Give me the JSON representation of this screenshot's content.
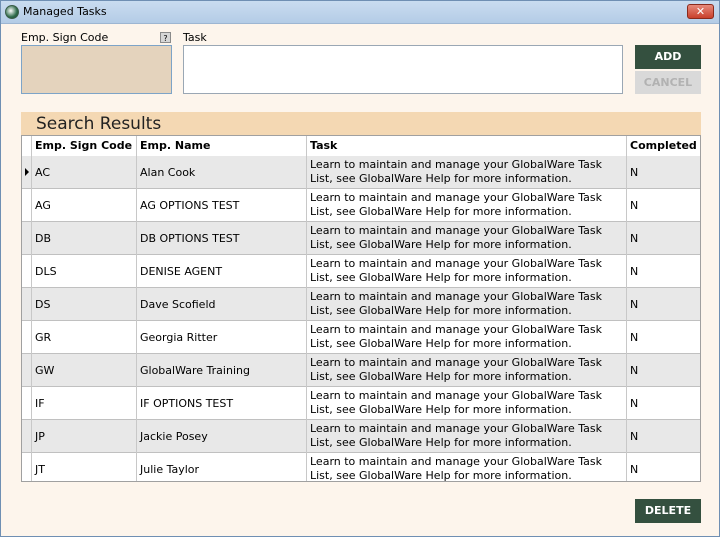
{
  "window": {
    "title": "Managed Tasks",
    "close_label": "✕"
  },
  "form": {
    "emp_sign_code_label": "Emp. Sign Code",
    "help_label": "?",
    "task_label": "Task",
    "emp_sign_code_value": "",
    "task_value": ""
  },
  "buttons": {
    "add": "ADD",
    "cancel": "CANCEL",
    "delete": "DELETE"
  },
  "results": {
    "title": "Search Results",
    "columns": [
      "Emp. Sign Code",
      "Emp. Name",
      "Task",
      "Completed"
    ],
    "rows": [
      {
        "code": "AC",
        "name": "Alan Cook",
        "task": "Learn to maintain and manage your GlobalWare Task List, see GlobalWare Help for more information.",
        "completed": "N"
      },
      {
        "code": "AG",
        "name": "AG OPTIONS TEST",
        "task": "Learn to maintain and manage your GlobalWare Task List, see GlobalWare Help for more information.",
        "completed": "N"
      },
      {
        "code": "DB",
        "name": "DB OPTIONS TEST",
        "task": "Learn to maintain and manage your GlobalWare Task List, see GlobalWare Help for more information.",
        "completed": "N"
      },
      {
        "code": "DLS",
        "name": "DENISE AGENT",
        "task": "Learn to maintain and manage your GlobalWare Task List, see GlobalWare Help for more information.",
        "completed": "N"
      },
      {
        "code": "DS",
        "name": "Dave Scofield",
        "task": "Learn to maintain and manage your GlobalWare Task List, see GlobalWare Help for more information.",
        "completed": "N"
      },
      {
        "code": "GR",
        "name": "Georgia Ritter",
        "task": "Learn to maintain and manage your GlobalWare Task List, see GlobalWare Help for more information.",
        "completed": "N"
      },
      {
        "code": "GW",
        "name": "GlobalWare Training",
        "task": "Learn to maintain and manage your GlobalWare Task List, see GlobalWare Help for more information.",
        "completed": "N"
      },
      {
        "code": "IF",
        "name": "IF OPTIONS TEST",
        "task": "Learn to maintain and manage your GlobalWare Task List, see GlobalWare Help for more information.",
        "completed": "N"
      },
      {
        "code": "JP",
        "name": "Jackie Posey",
        "task": "Learn to maintain and manage your GlobalWare Task List, see GlobalWare Help for more information.",
        "completed": "N"
      },
      {
        "code": "JT",
        "name": "Julie Taylor",
        "task": "Learn to maintain and manage your GlobalWare Task List, see GlobalWare Help for more information.",
        "completed": "N"
      }
    ]
  }
}
